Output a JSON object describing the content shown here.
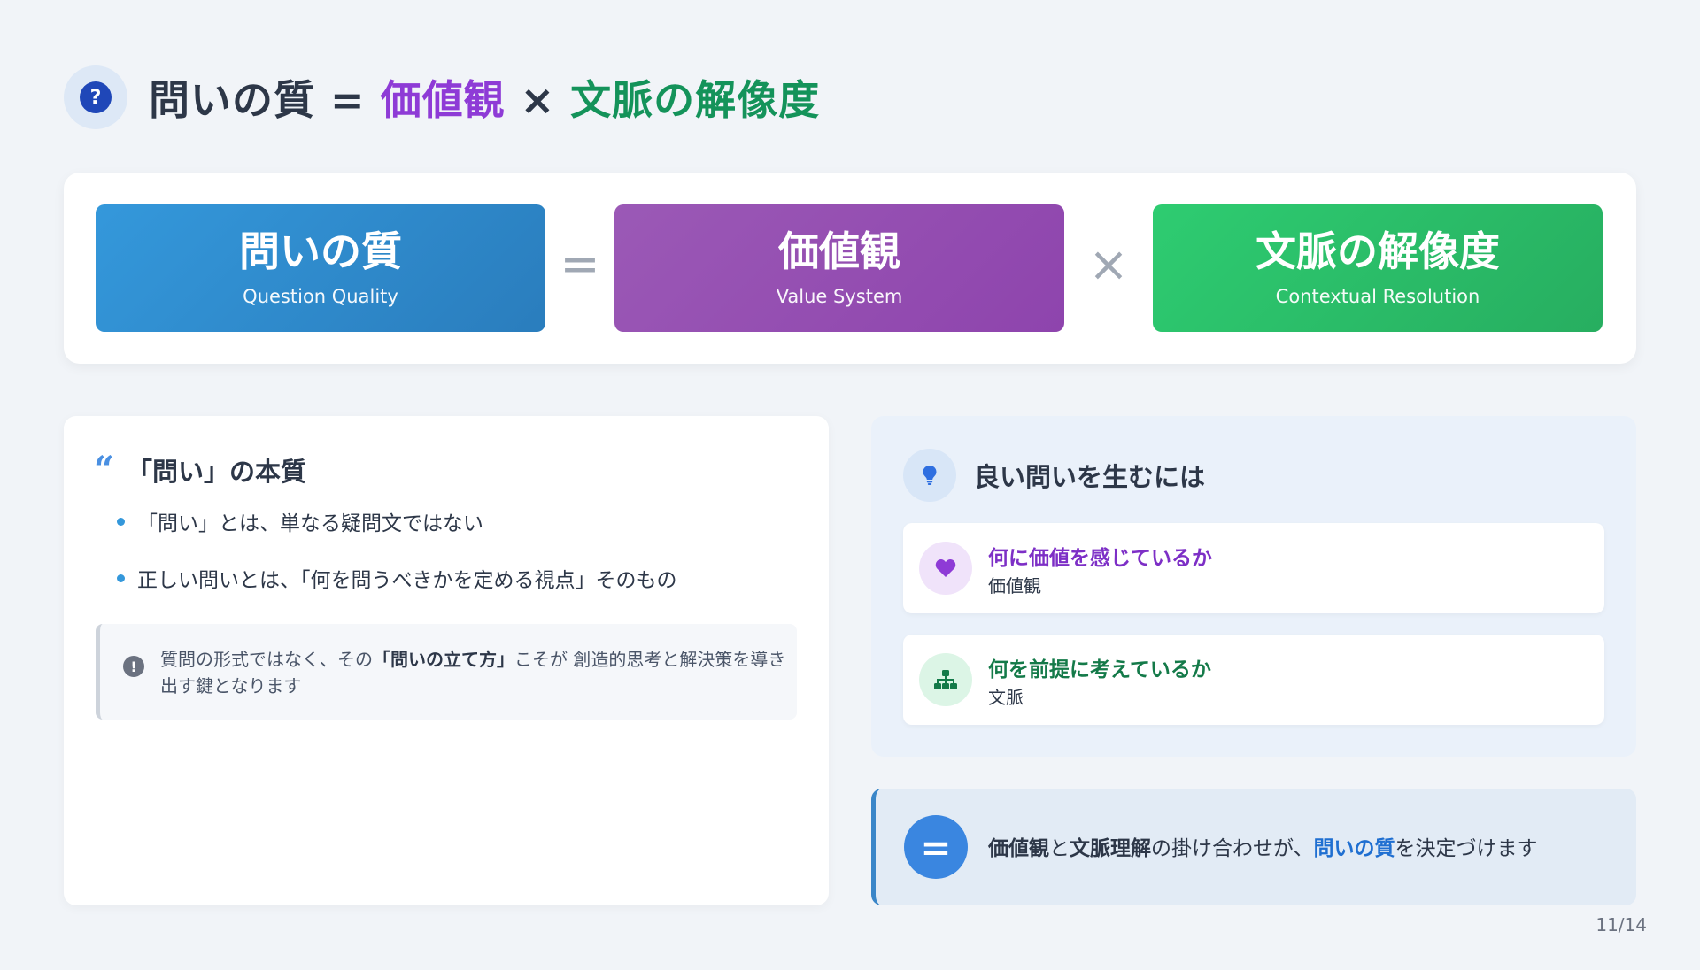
{
  "header": {
    "icon": "question-circle-icon",
    "title_part1": "問いの質",
    "title_eq": " = ",
    "title_part2": "価値観",
    "title_x": " × ",
    "title_part3": "文脈の解像度",
    "colors": {
      "purple": "#8e3bd6",
      "green": "#14935a"
    }
  },
  "formula": {
    "boxes": [
      {
        "main": "問いの質",
        "sub": "Question Quality",
        "color": "#3498db"
      },
      {
        "main": "価値観",
        "sub": "Value System",
        "color": "#9b59b6"
      },
      {
        "main": "文脈の解像度",
        "sub": "Contextual Resolution",
        "color": "#2ecc71"
      }
    ],
    "operator_equals": "=",
    "operator_times": "×"
  },
  "essence": {
    "icon": "quote-icon",
    "title": "「問い」の本質",
    "bullets": [
      "「問い」とは、単なる疑問文ではない",
      "正しい問いとは、「何を問うべきかを定める視点」そのもの"
    ],
    "note": {
      "icon": "exclamation-circle-icon",
      "pre": "質問の形式ではなく、その",
      "bold": "「問いの立て方」",
      "post": "こそが 創造的思考と解決策を導き出す鍵となります"
    }
  },
  "good_questions": {
    "icon": "lightbulb-icon",
    "title": "良い問いを生むには",
    "items": [
      {
        "icon": "heart-icon",
        "title": "何に価値を感じているか",
        "sub": "価値観",
        "color": "#7d2fc6"
      },
      {
        "icon": "sitemap-icon",
        "title": "何を前提に考えているか",
        "sub": "文脈",
        "color": "#147a49"
      }
    ]
  },
  "conclusion": {
    "icon": "equals-icon",
    "symbol": "=",
    "bold1": "価値観",
    "text1": "と",
    "bold2": "文脈理解",
    "text2": "の掛け合わせが、",
    "highlight": "問いの質",
    "text3": "を決定づけます"
  },
  "page": {
    "number": "11/14"
  }
}
